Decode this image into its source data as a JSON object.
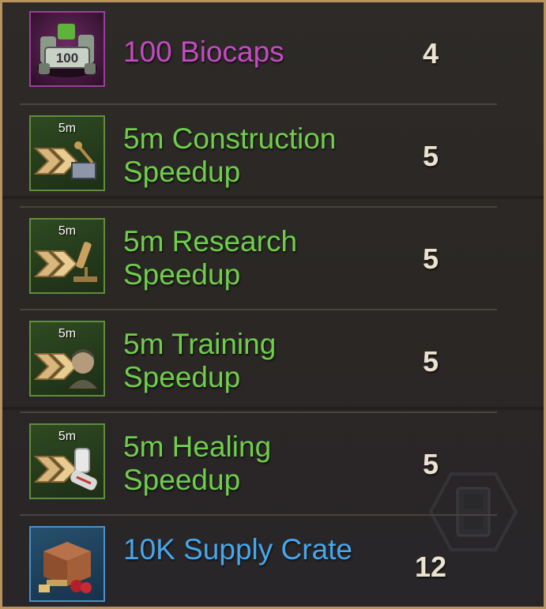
{
  "rewards": [
    {
      "name": "100 Biocaps",
      "count": "4",
      "rarity": "purple",
      "icon": "biocaps-pile-icon",
      "icon_tag": "",
      "icon_label": "100"
    },
    {
      "name": "5m Construction Speedup",
      "count": "5",
      "rarity": "green",
      "icon": "construction-speedup-icon",
      "icon_tag": "5m"
    },
    {
      "name": "5m Research Speedup",
      "count": "5",
      "rarity": "green",
      "icon": "research-speedup-icon",
      "icon_tag": "5m"
    },
    {
      "name": "5m Training Speedup",
      "count": "5",
      "rarity": "green",
      "icon": "training-speedup-icon",
      "icon_tag": "5m"
    },
    {
      "name": "5m Healing Speedup",
      "count": "5",
      "rarity": "green",
      "icon": "healing-speedup-icon",
      "icon_tag": "5m"
    },
    {
      "name": "10K Supply Crate",
      "count": "12",
      "rarity": "blue",
      "icon": "supply-crate-icon",
      "icon_tag": ""
    }
  ],
  "colors": {
    "purple": "#c44bc4",
    "green": "#6fce4a",
    "blue": "#47a7ea",
    "count": "#ece2d0",
    "frame": "#b8935e"
  }
}
